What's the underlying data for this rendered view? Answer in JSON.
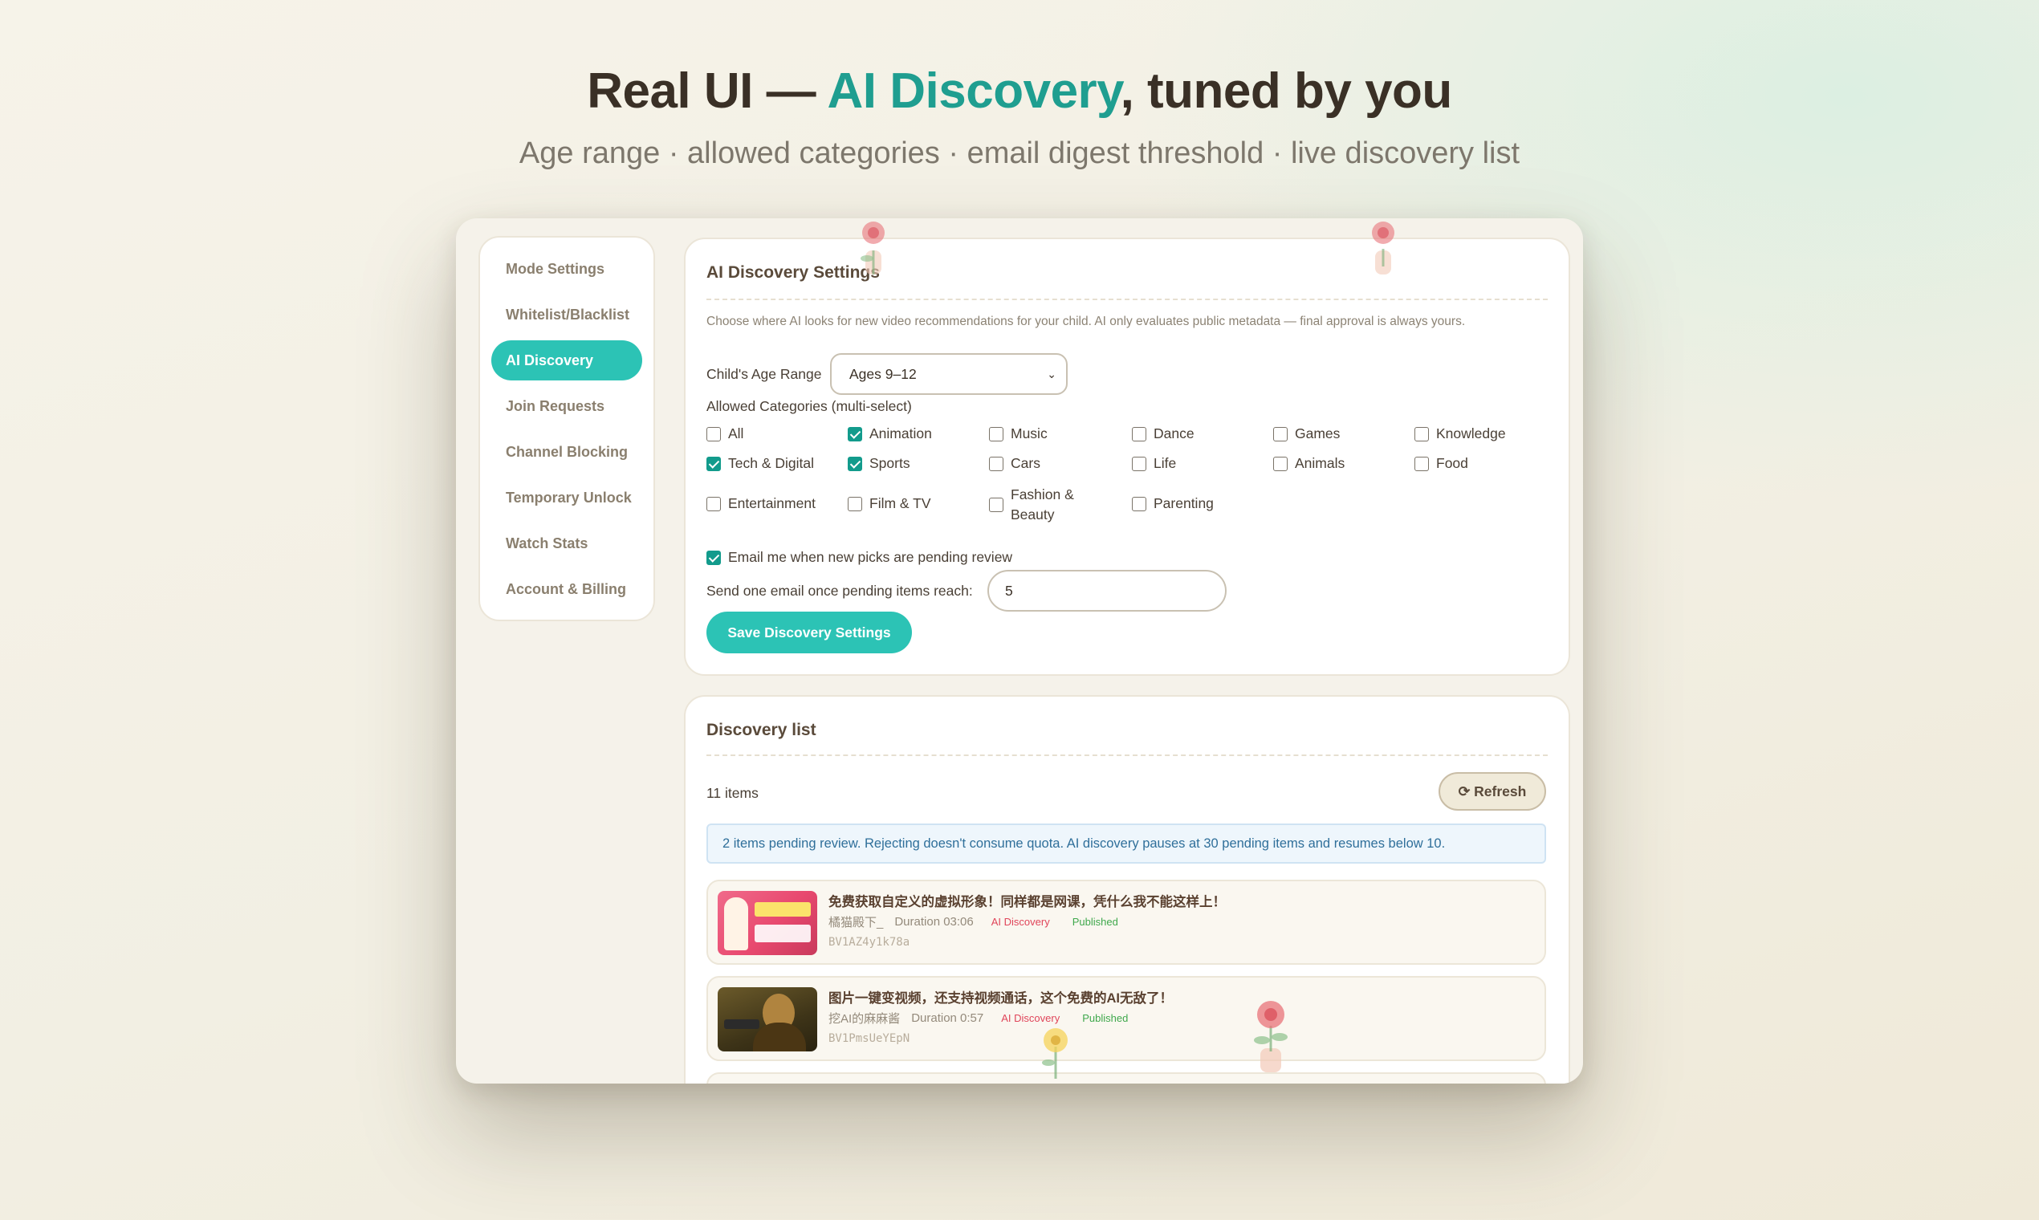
{
  "hero": {
    "title_pre": "Real UI — ",
    "title_accent": "AI Discovery",
    "title_post": ", tuned by you",
    "subtitle": "Age range · allowed categories · email digest threshold · live discovery list"
  },
  "sidebar": {
    "items": [
      {
        "label": "Mode Settings",
        "active": false
      },
      {
        "label": "Whitelist/Blacklist",
        "active": false
      },
      {
        "label": "AI Discovery",
        "active": true
      },
      {
        "label": "Join Requests",
        "active": false
      },
      {
        "label": "Channel Blocking",
        "active": false
      },
      {
        "label": "Temporary Unlock",
        "active": false
      },
      {
        "label": "Watch Stats",
        "active": false
      },
      {
        "label": "Account & Billing",
        "active": false
      }
    ]
  },
  "settings": {
    "title": "AI Discovery Settings",
    "description": "Choose where AI looks for new video recommendations for your child. AI only evaluates public metadata — final approval is always yours.",
    "age_label": "Child's Age Range",
    "age_value": "Ages 9–12",
    "categories_label": "Allowed Categories (multi-select)",
    "categories": [
      {
        "label": "All",
        "checked": false
      },
      {
        "label": "Animation",
        "checked": true
      },
      {
        "label": "Music",
        "checked": false
      },
      {
        "label": "Dance",
        "checked": false
      },
      {
        "label": "Games",
        "checked": false
      },
      {
        "label": "Knowledge",
        "checked": false
      },
      {
        "label": "Tech & Digital",
        "checked": true
      },
      {
        "label": "Sports",
        "checked": true
      },
      {
        "label": "Cars",
        "checked": false
      },
      {
        "label": "Life",
        "checked": false
      },
      {
        "label": "Animals",
        "checked": false
      },
      {
        "label": "Food",
        "checked": false
      },
      {
        "label": "Entertainment",
        "checked": false
      },
      {
        "label": "Film & TV",
        "checked": false
      },
      {
        "label": "Fashion &",
        "label2": "Beauty",
        "checked": false
      },
      {
        "label": "Parenting",
        "checked": false
      }
    ],
    "email_toggle_label": "Email me when new picks are pending review",
    "email_toggle_checked": true,
    "threshold_label": "Send one email once pending items reach:",
    "threshold_value": "5",
    "save_label": "Save Discovery Settings"
  },
  "discovery": {
    "title": "Discovery list",
    "count": "11 items",
    "refresh_label": "⟳ Refresh",
    "notice": "2 items pending review. Rejecting doesn't consume quota. AI discovery pauses at 30 pending items and resumes below 10.",
    "videos": [
      {
        "title": "免费获取自定义的虚拟形象！同样都是网课，凭什么我不能这样上！",
        "author": "橘猫殿下_",
        "duration": "Duration 03:06",
        "source": "AI Discovery",
        "status": "Published",
        "id": "BV1AZ4y1k78a"
      },
      {
        "title": "图片一键变视频，还支持视频通话，这个免费的AI无敌了！",
        "author": "挖AI的麻麻酱",
        "duration": "Duration 0:57",
        "source": "AI Discovery",
        "status": "Published",
        "id": "BV1PmsUeYEpN"
      }
    ]
  },
  "colors": {
    "accent": "#2cc3b5",
    "title_accent": "#1f9e90",
    "ai_tag": "#e0455a",
    "published_tag": "#3fa84c"
  }
}
